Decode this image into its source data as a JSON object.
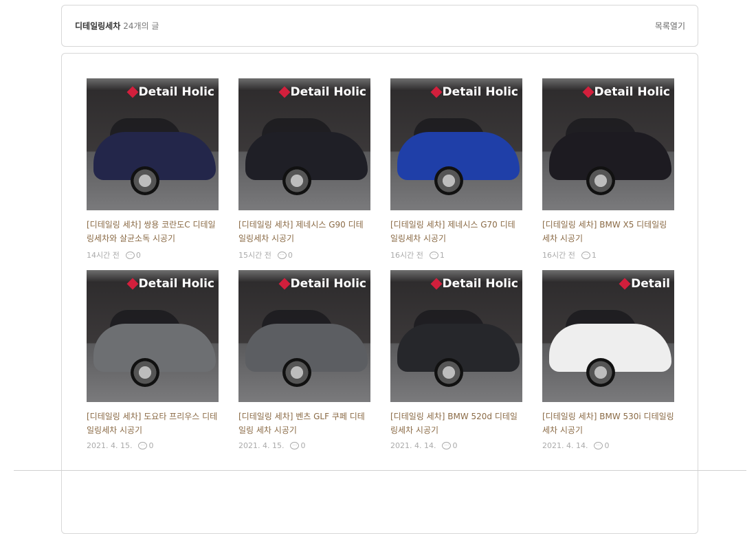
{
  "header": {
    "category": "디테일링세차",
    "count": "24개의 글",
    "toggle": "목록열기"
  },
  "colors": {
    "title": "#8a6a45",
    "accent": "#d21f3c"
  },
  "posts": [
    {
      "title": "[디테일링 세차] 쌍용 코란도C 디테일링세차와 살균소독 시공기",
      "time": "14시간 전",
      "comments": "0",
      "car_color": "#23264a",
      "brand": "Detail Holic"
    },
    {
      "title": "[디테일링 세차] 제네시스 G90 디테일링세차 시공기",
      "time": "15시간 전",
      "comments": "0",
      "car_color": "#1f1f26",
      "brand": "Detail Holic"
    },
    {
      "title": "[디테일링 세차] 제네시스 G70 디테일링세차 시공기",
      "time": "16시간 전",
      "comments": "1",
      "car_color": "#1f3fa8",
      "brand": "Detail Holic"
    },
    {
      "title": "[디테일링 세차] BMW X5 디테일링세차 시공기",
      "time": "16시간 전",
      "comments": "1",
      "car_color": "#1d1b21",
      "brand": "Detail Holic"
    },
    {
      "title": "[디테일링 세차] 도요타 프리우스 디테일링세차 시공기",
      "time": "2021. 4. 15.",
      "comments": "0",
      "car_color": "#6d6f72",
      "brand": "Detail Holic"
    },
    {
      "title": "[디테일링 세차] 벤츠 GLF 쿠페 디테일링 세차 시공기",
      "time": "2021. 4. 15.",
      "comments": "0",
      "car_color": "#5c5e62",
      "brand": "Detail Holic"
    },
    {
      "title": "[디테일링 세차] BMW 520d 디테일링세차 시공기",
      "time": "2021. 4. 14.",
      "comments": "0",
      "car_color": "#26272b",
      "brand": "Detail Holic"
    },
    {
      "title": "[디테일링 세차] BMW 530i 디테일링세차 시공기",
      "time": "2021. 4. 14.",
      "comments": "0",
      "car_color": "#eeeeee",
      "brand": "Detail"
    }
  ]
}
